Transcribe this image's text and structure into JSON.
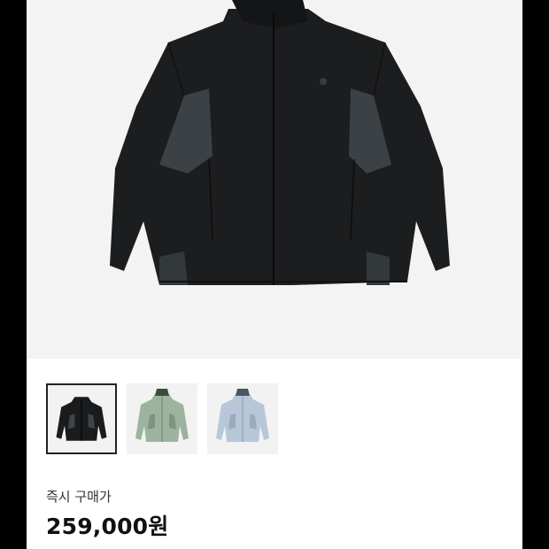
{
  "product": {
    "image_icon": "jacket-front-image",
    "colorways": [
      {
        "name": "black",
        "color": "#1a1b1d",
        "accent": "#3e4548",
        "selected": true
      },
      {
        "name": "sage",
        "color": "#9eb39e",
        "accent": "#7f9480",
        "selected": false
      },
      {
        "name": "light-blue",
        "color": "#b8c7d8",
        "accent": "#9aabbf",
        "selected": false
      }
    ]
  },
  "buy_now": {
    "label": "즉시 구매가",
    "price": "259,000원"
  },
  "colors": {
    "background_side": "#000000",
    "hero_bg": "#f3f3f3"
  }
}
